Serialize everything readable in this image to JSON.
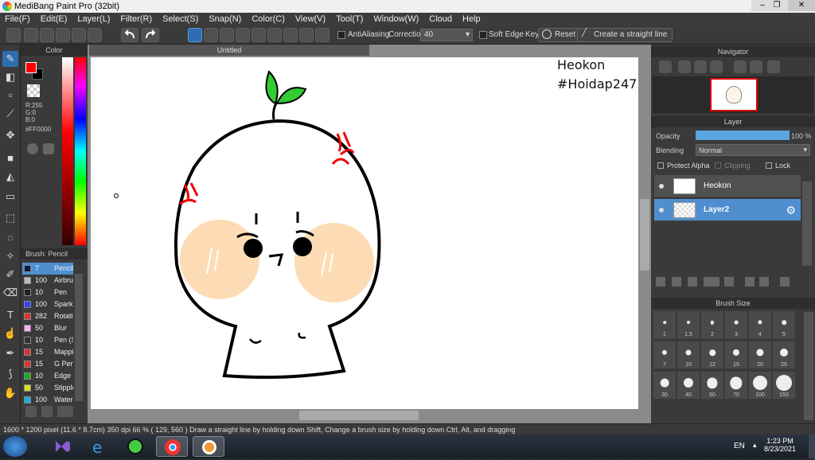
{
  "window": {
    "title": "MediBang Paint Pro (32bit)"
  },
  "menu": [
    "File(F)",
    "Edit(E)",
    "Layer(L)",
    "Filter(R)",
    "Select(S)",
    "Snap(N)",
    "Color(C)",
    "View(V)",
    "Tool(T)",
    "Window(W)",
    "Cloud",
    "Help"
  ],
  "toolbar": {
    "antialias_label": "AntiAliasing",
    "correction_label": "Correction",
    "correction_value": "40",
    "softedge_label": "Soft Edge",
    "key_label": "Key",
    "reset_label": "Reset",
    "straight_line_label": "Create a straight line"
  },
  "color_panel": {
    "title": "Color",
    "rgb": [
      "R:255",
      "G:0",
      "B:0"
    ],
    "hex": "#FF0000",
    "fg_color": "#ff0000",
    "bg_color": "#000000"
  },
  "brush_panel": {
    "title": "Brush: Pencil",
    "items": [
      {
        "size": "7",
        "name": "Pencil",
        "color": "#0a1a40"
      },
      {
        "size": "100",
        "name": "Airbrush",
        "color": "#bbbbbb"
      },
      {
        "size": "10",
        "name": "Pen",
        "color": "#222222"
      },
      {
        "size": "100",
        "name": "Sparkle",
        "color": "#3344ff"
      },
      {
        "size": "282",
        "name": "Rotation",
        "color": "#dd3333"
      },
      {
        "size": "50",
        "name": "Blur",
        "color": "#ffaaff"
      },
      {
        "size": "10",
        "name": "Pen (S)",
        "color": "#333333"
      },
      {
        "size": "15",
        "name": "Mapping",
        "color": "#dd3333"
      },
      {
        "size": "15",
        "name": "G Pen",
        "color": "#dd3333"
      },
      {
        "size": "10",
        "name": "Edge",
        "color": "#22aa22"
      },
      {
        "size": "50",
        "name": "Stipple",
        "color": "#dddd22"
      },
      {
        "size": "100",
        "name": "Watercolor",
        "color": "#22aadd"
      }
    ]
  },
  "document": {
    "tab_title": "Untitled",
    "overlay_line1": "Heokon",
    "overlay_line2": "#Hoidap247"
  },
  "navigator": {
    "title": "Navigator"
  },
  "layer_panel": {
    "title": "Layer",
    "opacity_label": "Opacity",
    "opacity_value": "100 %",
    "opacity_fraction": 1.0,
    "blending_label": "Blending",
    "blending_value": "Normal",
    "protect_alpha_label": "Protect Alpha",
    "clipping_label": "Clipping",
    "lock_label": "Lock",
    "layers": [
      {
        "name": "Heokon",
        "selected": false
      },
      {
        "name": "Layer2",
        "selected": true
      }
    ]
  },
  "brush_size_panel": {
    "title": "Brush Size",
    "sizes": [
      "1",
      "1.5",
      "2",
      "3",
      "4",
      "5",
      "7",
      "10",
      "12",
      "15",
      "20",
      "25",
      "30",
      "40",
      "50",
      "70",
      "100",
      "150"
    ]
  },
  "status": {
    "dimensions": "1600 * 1200 pixel",
    "physical": "(11.6 * 8.7cm)",
    "dpi": "350 dpi",
    "zoom": "66 %",
    "cursor": "( 129, 560 )",
    "hint": "Draw a straight line by holding down Shift, Change a brush size by holding down Ctrl, Alt, and dragging"
  },
  "taskbar": {
    "language": "EN",
    "time": "1:23 PM",
    "date": "8/23/2021"
  }
}
